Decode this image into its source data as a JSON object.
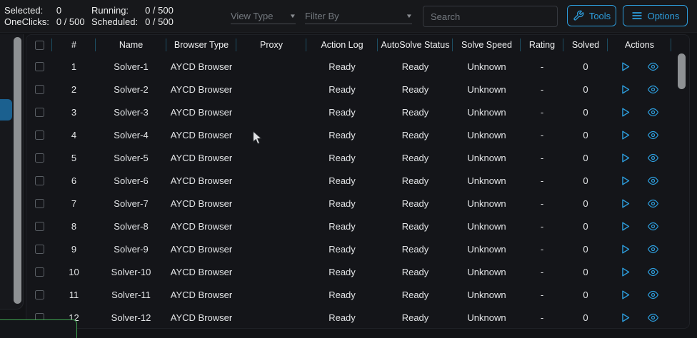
{
  "colors": {
    "accent": "#2d9cdb",
    "page_bg": "#121316",
    "topbar_bg": "#17181b",
    "panel_bg": "#141519",
    "sidebar_bg": "#17181c",
    "text": "#e8e9ea",
    "muted_text": "#757a80",
    "header_divider": "#1d4e63",
    "scrollbar": "#8e9194",
    "tab_blue": "#1b608f",
    "green_accent": "#3fa050"
  },
  "topbar": {
    "stats": [
      {
        "label": "Selected:",
        "value": "0"
      },
      {
        "label": "OneClicks:",
        "value": "0 / 500"
      },
      {
        "label": "Running:",
        "value": "0 / 500"
      },
      {
        "label": "Scheduled:",
        "value": "0 / 500"
      }
    ],
    "view_type_label": "View Type",
    "filter_by_label": "Filter By",
    "search_placeholder": "Search",
    "tools_label": "Tools",
    "options_label": "Options"
  },
  "table": {
    "columns": [
      "#",
      "Name",
      "Browser Type",
      "Proxy",
      "Action Log",
      "AutoSolve Status",
      "Solve Speed",
      "Rating",
      "Solved",
      "Actions"
    ],
    "rows": [
      {
        "num": "1",
        "name": "Solver-1",
        "browser_type": "AYCD Browser",
        "proxy": "",
        "action_log": "Ready",
        "autosolve_status": "Ready",
        "solve_speed": "Unknown",
        "rating": "-",
        "solved": "0"
      },
      {
        "num": "2",
        "name": "Solver-2",
        "browser_type": "AYCD Browser",
        "proxy": "",
        "action_log": "Ready",
        "autosolve_status": "Ready",
        "solve_speed": "Unknown",
        "rating": "-",
        "solved": "0"
      },
      {
        "num": "3",
        "name": "Solver-3",
        "browser_type": "AYCD Browser",
        "proxy": "",
        "action_log": "Ready",
        "autosolve_status": "Ready",
        "solve_speed": "Unknown",
        "rating": "-",
        "solved": "0"
      },
      {
        "num": "4",
        "name": "Solver-4",
        "browser_type": "AYCD Browser",
        "proxy": "",
        "action_log": "Ready",
        "autosolve_status": "Ready",
        "solve_speed": "Unknown",
        "rating": "-",
        "solved": "0"
      },
      {
        "num": "5",
        "name": "Solver-5",
        "browser_type": "AYCD Browser",
        "proxy": "",
        "action_log": "Ready",
        "autosolve_status": "Ready",
        "solve_speed": "Unknown",
        "rating": "-",
        "solved": "0"
      },
      {
        "num": "6",
        "name": "Solver-6",
        "browser_type": "AYCD Browser",
        "proxy": "",
        "action_log": "Ready",
        "autosolve_status": "Ready",
        "solve_speed": "Unknown",
        "rating": "-",
        "solved": "0"
      },
      {
        "num": "7",
        "name": "Solver-7",
        "browser_type": "AYCD Browser",
        "proxy": "",
        "action_log": "Ready",
        "autosolve_status": "Ready",
        "solve_speed": "Unknown",
        "rating": "-",
        "solved": "0"
      },
      {
        "num": "8",
        "name": "Solver-8",
        "browser_type": "AYCD Browser",
        "proxy": "",
        "action_log": "Ready",
        "autosolve_status": "Ready",
        "solve_speed": "Unknown",
        "rating": "-",
        "solved": "0"
      },
      {
        "num": "9",
        "name": "Solver-9",
        "browser_type": "AYCD Browser",
        "proxy": "",
        "action_log": "Ready",
        "autosolve_status": "Ready",
        "solve_speed": "Unknown",
        "rating": "-",
        "solved": "0"
      },
      {
        "num": "10",
        "name": "Solver-10",
        "browser_type": "AYCD Browser",
        "proxy": "",
        "action_log": "Ready",
        "autosolve_status": "Ready",
        "solve_speed": "Unknown",
        "rating": "-",
        "solved": "0"
      },
      {
        "num": "11",
        "name": "Solver-11",
        "browser_type": "AYCD Browser",
        "proxy": "",
        "action_log": "Ready",
        "autosolve_status": "Ready",
        "solve_speed": "Unknown",
        "rating": "-",
        "solved": "0"
      },
      {
        "num": "12",
        "name": "Solver-12",
        "browser_type": "AYCD Browser",
        "proxy": "",
        "action_log": "Ready",
        "autosolve_status": "Ready",
        "solve_speed": "Unknown",
        "rating": "-",
        "solved": "0"
      }
    ]
  },
  "icons": {
    "tools": "wrench-icon",
    "options": "hamburger-icon",
    "row_play": "play-icon",
    "row_view": "eye-icon"
  }
}
